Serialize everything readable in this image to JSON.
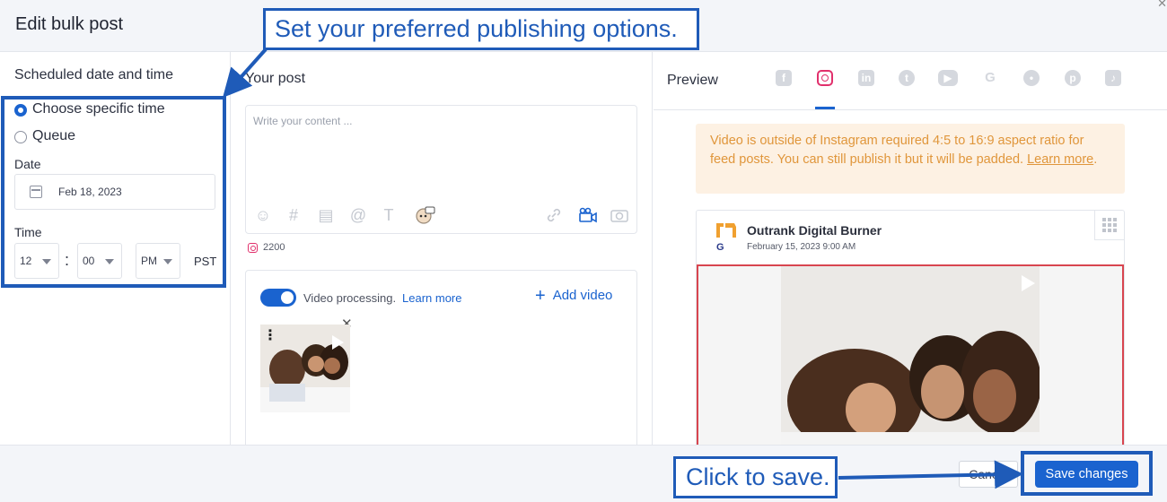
{
  "header": {
    "title": "Edit bulk post"
  },
  "schedule": {
    "title": "Scheduled date and time",
    "options": [
      "Choose specific time",
      "Queue"
    ],
    "selected": "Choose specific time",
    "date_label": "Date",
    "date_value": "Feb 18, 2023",
    "time_label": "Time",
    "hour": "12",
    "minute": "00",
    "ampm": "PM",
    "timezone": "PST",
    "colon": ":"
  },
  "post": {
    "title": "Your post",
    "placeholder": "Write your content ...",
    "char_count": "2200",
    "toolbar_icons": [
      "emoji-icon",
      "hashtag-icon",
      "template-icon",
      "mention-icon",
      "text-format-icon",
      "ai-assistant-icon",
      "link-icon",
      "video-icon",
      "camera-icon"
    ],
    "video_processing_label": "Video processing.",
    "video_processing_link": "Learn more",
    "add_video_label": "Add video",
    "video_processing_enabled": true
  },
  "preview": {
    "title": "Preview",
    "tabs": [
      "facebook",
      "instagram",
      "linkedin",
      "twitter",
      "youtube",
      "google",
      "reddit",
      "pinterest",
      "tiktok"
    ],
    "active_tab": "instagram",
    "warning_text": "Video is outside of Instagram required 4:5 to 16:9 aspect ratio for feed posts. You can still publish it but it will be padded. ",
    "warning_link": "Learn more",
    "warning_end": ".",
    "account_name": "Outrank Digital Burner",
    "post_date": "February 15, 2023 9:00 AM"
  },
  "footer": {
    "cancel_label": "Cancel",
    "save_label": "Save changes"
  },
  "annotations": {
    "top": "Set your preferred publishing options.",
    "bottom": "Click to save."
  },
  "colors": {
    "accent": "#1a63cf",
    "annotation": "#1f5bb8",
    "warning_bg": "#fdf1e3",
    "warning_text": "#e0963b",
    "instagram": "#e1306c"
  }
}
